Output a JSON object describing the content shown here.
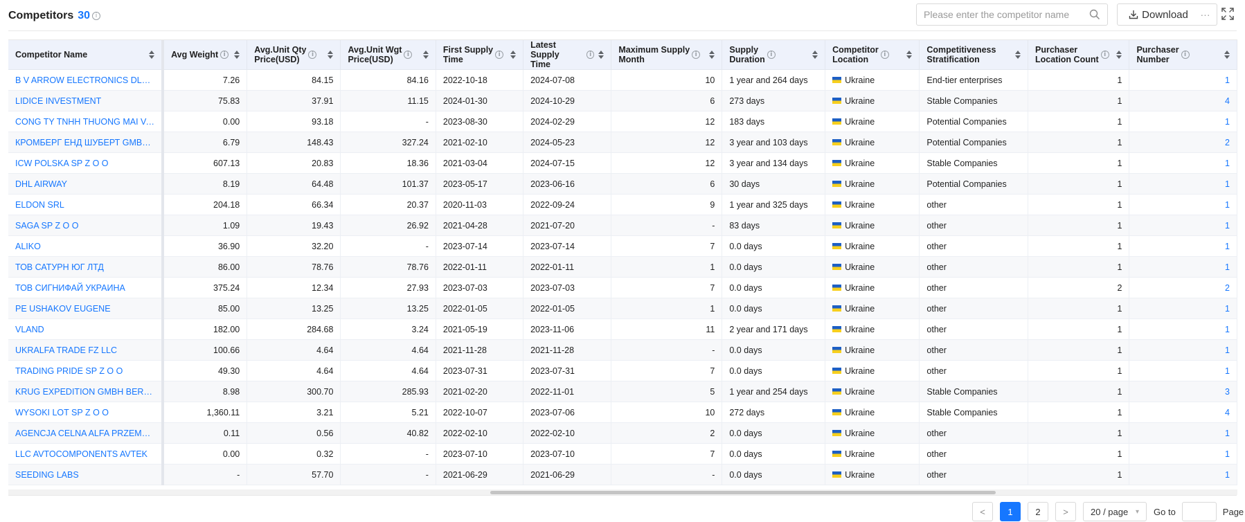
{
  "header": {
    "title": "Competitors",
    "count": "30",
    "info_glyph": "i"
  },
  "search": {
    "placeholder": "Please enter the competitor name",
    "icon": "search-icon"
  },
  "toolbar": {
    "download_label": "Download",
    "more_label": "···",
    "download_icon": "download-icon",
    "fullscreen_icon": "fullscreen-icon"
  },
  "table": {
    "columns": [
      {
        "key": "name",
        "label1": "Competitor Name",
        "label2": "",
        "info": false
      },
      {
        "key": "avg_weight",
        "label1": "Avg Weight",
        "label2": "",
        "info": true
      },
      {
        "key": "qty_price",
        "label1": "Avg.Unit Qty",
        "label2": "Price(USD)",
        "info": true
      },
      {
        "key": "wgt_price",
        "label1": "Avg.Unit Wgt",
        "label2": "Price(USD)",
        "info": true
      },
      {
        "key": "first_supply",
        "label1": "First Supply",
        "label2": "Time",
        "info": true
      },
      {
        "key": "latest_supply",
        "label1": "Latest Supply",
        "label2": "Time",
        "info": true
      },
      {
        "key": "max_month",
        "label1": "Maximum Supply",
        "label2": "Month",
        "info": true
      },
      {
        "key": "duration",
        "label1": "Supply",
        "label2": "Duration",
        "info": true
      },
      {
        "key": "location",
        "label1": "Competitor",
        "label2": "Location",
        "info": true
      },
      {
        "key": "stratification",
        "label1": "Competitiveness",
        "label2": "Stratification",
        "info": false
      },
      {
        "key": "purchaser_loc",
        "label1": "Purchaser",
        "label2": "Location Count",
        "info": true
      },
      {
        "key": "purchaser_num",
        "label1": "Purchaser",
        "label2": "Number",
        "info": true
      }
    ],
    "rows": [
      {
        "name": "B V ARROW ELECTRONICS DLC TRADING LLC",
        "avg_weight": "7.26",
        "qty_price": "84.15",
        "wgt_price": "84.16",
        "first_supply": "2022-10-18",
        "latest_supply": "2024-07-08",
        "max_month": "10",
        "duration": "1 year and 264 days",
        "location": "Ukraine",
        "stratification": "End-tier enterprises",
        "purchaser_loc": "1",
        "purchaser_num": "1"
      },
      {
        "name": "LIDICE INVESTMENT",
        "avg_weight": "75.83",
        "qty_price": "37.91",
        "wgt_price": "11.15",
        "first_supply": "2024-01-30",
        "latest_supply": "2024-10-29",
        "max_month": "6",
        "duration": "273 days",
        "location": "Ukraine",
        "stratification": "Stable Companies",
        "purchaser_loc": "1",
        "purchaser_num": "4"
      },
      {
        "name": "CONG TY TNHH THUONG MAI VA DICH VU",
        "avg_weight": "0.00",
        "qty_price": "93.18",
        "wgt_price": "-",
        "first_supply": "2023-08-30",
        "latest_supply": "2024-02-29",
        "max_month": "12",
        "duration": "183 days",
        "location": "Ukraine",
        "stratification": "Potential Companies",
        "purchaser_loc": "1",
        "purchaser_num": "1"
      },
      {
        "name": "КРОМБЕРГ ЕНД ШУБЕРТ GMBH LANDSTRASSE",
        "avg_weight": "6.79",
        "qty_price": "148.43",
        "wgt_price": "327.24",
        "first_supply": "2021-02-10",
        "latest_supply": "2024-05-23",
        "max_month": "12",
        "duration": "3 year and 103 days",
        "location": "Ukraine",
        "stratification": "Potential Companies",
        "purchaser_loc": "1",
        "purchaser_num": "2"
      },
      {
        "name": "ICW POLSKA SP Z O O",
        "avg_weight": "607.13",
        "qty_price": "20.83",
        "wgt_price": "18.36",
        "first_supply": "2021-03-04",
        "latest_supply": "2024-07-15",
        "max_month": "12",
        "duration": "3 year and 134 days",
        "location": "Ukraine",
        "stratification": "Stable Companies",
        "purchaser_loc": "1",
        "purchaser_num": "1"
      },
      {
        "name": "DHL AIRWAY",
        "avg_weight": "8.19",
        "qty_price": "64.48",
        "wgt_price": "101.37",
        "first_supply": "2023-05-17",
        "latest_supply": "2023-06-16",
        "max_month": "6",
        "duration": "30 days",
        "location": "Ukraine",
        "stratification": "Potential Companies",
        "purchaser_loc": "1",
        "purchaser_num": "1"
      },
      {
        "name": "ELDON SRL",
        "avg_weight": "204.18",
        "qty_price": "66.34",
        "wgt_price": "20.37",
        "first_supply": "2020-11-03",
        "latest_supply": "2022-09-24",
        "max_month": "9",
        "duration": "1 year and 325 days",
        "location": "Ukraine",
        "stratification": "other",
        "purchaser_loc": "1",
        "purchaser_num": "1"
      },
      {
        "name": "SAGA SP Z O O",
        "avg_weight": "1.09",
        "qty_price": "19.43",
        "wgt_price": "26.92",
        "first_supply": "2021-04-28",
        "latest_supply": "2021-07-20",
        "max_month": "-",
        "duration": "83 days",
        "location": "Ukraine",
        "stratification": "other",
        "purchaser_loc": "1",
        "purchaser_num": "1"
      },
      {
        "name": "ALIKO",
        "avg_weight": "36.90",
        "qty_price": "32.20",
        "wgt_price": "-",
        "first_supply": "2023-07-14",
        "latest_supply": "2023-07-14",
        "max_month": "7",
        "duration": "0.0 days",
        "location": "Ukraine",
        "stratification": "other",
        "purchaser_loc": "1",
        "purchaser_num": "1"
      },
      {
        "name": "ТОВ САТУРН ЮГ ЛТД",
        "avg_weight": "86.00",
        "qty_price": "78.76",
        "wgt_price": "78.76",
        "first_supply": "2022-01-11",
        "latest_supply": "2022-01-11",
        "max_month": "1",
        "duration": "0.0 days",
        "location": "Ukraine",
        "stratification": "other",
        "purchaser_loc": "1",
        "purchaser_num": "1"
      },
      {
        "name": "ТОВ СИГНИФАЙ УКРАИНА",
        "avg_weight": "375.24",
        "qty_price": "12.34",
        "wgt_price": "27.93",
        "first_supply": "2023-07-03",
        "latest_supply": "2023-07-03",
        "max_month": "7",
        "duration": "0.0 days",
        "location": "Ukraine",
        "stratification": "other",
        "purchaser_loc": "2",
        "purchaser_num": "2"
      },
      {
        "name": "PE USHAKOV EUGENE",
        "avg_weight": "85.00",
        "qty_price": "13.25",
        "wgt_price": "13.25",
        "first_supply": "2022-01-05",
        "latest_supply": "2022-01-05",
        "max_month": "1",
        "duration": "0.0 days",
        "location": "Ukraine",
        "stratification": "other",
        "purchaser_loc": "1",
        "purchaser_num": "1"
      },
      {
        "name": "VLAND",
        "avg_weight": "182.00",
        "qty_price": "284.68",
        "wgt_price": "3.24",
        "first_supply": "2021-05-19",
        "latest_supply": "2023-11-06",
        "max_month": "11",
        "duration": "2 year and 171 days",
        "location": "Ukraine",
        "stratification": "other",
        "purchaser_loc": "1",
        "purchaser_num": "1"
      },
      {
        "name": "UKRALFA TRADE FZ LLC",
        "avg_weight": "100.66",
        "qty_price": "4.64",
        "wgt_price": "4.64",
        "first_supply": "2021-11-28",
        "latest_supply": "2021-11-28",
        "max_month": "-",
        "duration": "0.0 days",
        "location": "Ukraine",
        "stratification": "other",
        "purchaser_loc": "1",
        "purchaser_num": "1"
      },
      {
        "name": "TRADING PRIDE SP Z O O",
        "avg_weight": "49.30",
        "qty_price": "4.64",
        "wgt_price": "4.64",
        "first_supply": "2023-07-31",
        "latest_supply": "2023-07-31",
        "max_month": "7",
        "duration": "0.0 days",
        "location": "Ukraine",
        "stratification": "other",
        "purchaser_loc": "1",
        "purchaser_num": "1"
      },
      {
        "name": "KRUG EXPEDITION GMBH BERGWERKSTRASSE",
        "avg_weight": "8.98",
        "qty_price": "300.70",
        "wgt_price": "285.93",
        "first_supply": "2021-02-20",
        "latest_supply": "2022-11-01",
        "max_month": "5",
        "duration": "1 year and 254 days",
        "location": "Ukraine",
        "stratification": "Stable Companies",
        "purchaser_loc": "1",
        "purchaser_num": "3"
      },
      {
        "name": "WYSOKI LOT SP Z O O",
        "avg_weight": "1,360.11",
        "qty_price": "3.21",
        "wgt_price": "5.21",
        "first_supply": "2022-10-07",
        "latest_supply": "2023-07-06",
        "max_month": "10",
        "duration": "272 days",
        "location": "Ukraine",
        "stratification": "Stable Companies",
        "purchaser_loc": "1",
        "purchaser_num": "4"
      },
      {
        "name": "AGENCJA CELNA ALFA PRZEMYSLOWA",
        "avg_weight": "0.11",
        "qty_price": "0.56",
        "wgt_price": "40.82",
        "first_supply": "2022-02-10",
        "latest_supply": "2022-02-10",
        "max_month": "2",
        "duration": "0.0 days",
        "location": "Ukraine",
        "stratification": "other",
        "purchaser_loc": "1",
        "purchaser_num": "1"
      },
      {
        "name": "LLC AVTOCOMPONENTS AVTEK",
        "avg_weight": "0.00",
        "qty_price": "0.32",
        "wgt_price": "-",
        "first_supply": "2023-07-10",
        "latest_supply": "2023-07-10",
        "max_month": "7",
        "duration": "0.0 days",
        "location": "Ukraine",
        "stratification": "other",
        "purchaser_loc": "1",
        "purchaser_num": "1"
      },
      {
        "name": "SEEDING LABS",
        "avg_weight": "-",
        "qty_price": "57.70",
        "wgt_price": "-",
        "first_supply": "2021-06-29",
        "latest_supply": "2021-06-29",
        "max_month": "-",
        "duration": "0.0 days",
        "location": "Ukraine",
        "stratification": "other",
        "purchaser_loc": "1",
        "purchaser_num": "1"
      }
    ]
  },
  "pagination": {
    "prev": "<",
    "pages": [
      "1",
      "2"
    ],
    "current": "1",
    "next": ">",
    "page_size": "20 / page",
    "goto_label": "Go to",
    "goto_value": "",
    "page_label": "Page"
  },
  "colors": {
    "accent": "#1677ff",
    "header_bg": "#eef2fb",
    "flag_blue": "#1d5fc4",
    "flag_yellow": "#f7cf1d"
  }
}
